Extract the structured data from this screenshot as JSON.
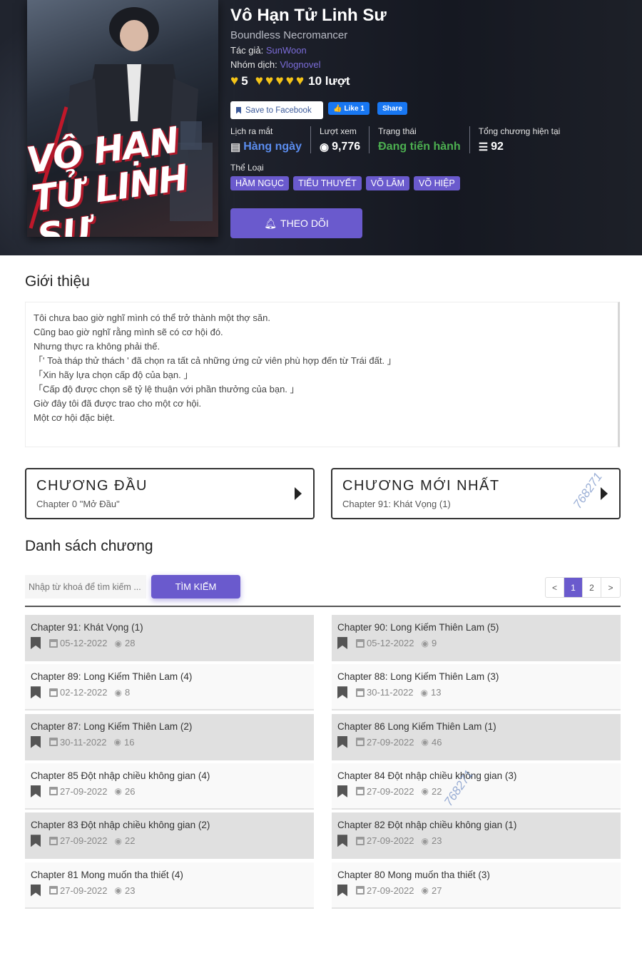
{
  "manga": {
    "title": "Vô Hạn Tử Linh Sư",
    "alt_title": "Boundless Necromancer",
    "author_label": "Tác giả:",
    "author": "SunWoon",
    "group_label": "Nhóm dịch:",
    "group": "Vlognovel",
    "rating_value": "5",
    "rating_count": "10 lượt",
    "cover_text": "VÔ HẠN TỬ LINH SƯ"
  },
  "social": {
    "save_fb": "Save to Facebook",
    "like": "Like 1",
    "share": "Share"
  },
  "stats": {
    "release_label": "Lịch ra mắt",
    "release_value": "Hàng ngày",
    "views_label": "Lượt xem",
    "views_value": "9,776",
    "status_label": "Trạng thái",
    "status_value": "Đang tiến hành",
    "chapters_label": "Tổng chương hiện tại",
    "chapters_value": "92"
  },
  "genres_label": "Thể Loại",
  "genres": [
    "HẦM NGỤC",
    "TIỂU THUYẾT",
    "VÕ LÂM",
    "VÕ HIỆP"
  ],
  "follow_label": "THEO DÕI",
  "intro": {
    "title": "Giới thiệu",
    "lines": [
      "Tôi chưa bao giờ nghĩ mình có thể trở thành một thợ săn.",
      "Cũng bao giờ nghĩ rằng mình sẽ có cơ hội đó.",
      "Nhưng thực ra không phải thế.",
      "「' Toà tháp thử thách ' đã chọn ra tất cả những ứng cử viên phù hợp đến từ Trái đất. 」",
      "「Xin hãy lựa chọn cấp độ của bạn. 」",
      "「Cấp độ được chọn sẽ tỷ lệ thuận với phần thưởng của bạn. 」",
      "Giờ đây tôi đã được trao cho một cơ hội.",
      "Một cơ hội đặc biệt."
    ]
  },
  "first_chapter": {
    "heading": "CHƯƠNG ĐẦU",
    "sub": "Chapter 0 \"Mở Đầu\""
  },
  "latest_chapter": {
    "heading": "CHƯƠNG MỚI NHẤT",
    "sub": "Chapter 91: Khát Vọng (1)"
  },
  "list": {
    "title": "Danh sách chương",
    "search_placeholder": "Nhập từ khoá để tìm kiếm ...",
    "search_button": "TÌM KIẾM",
    "pager": [
      "<",
      "1",
      "2",
      ">"
    ],
    "chapters": [
      {
        "name": "Chapter 91: Khát Vọng (1)",
        "date": "05-12-2022",
        "views": "28"
      },
      {
        "name": "Chapter 90: Long Kiếm Thiên Lam (5)",
        "date": "05-12-2022",
        "views": "9"
      },
      {
        "name": "Chapter 89: Long Kiếm Thiên Lam (4)",
        "date": "02-12-2022",
        "views": "8"
      },
      {
        "name": "Chapter 88: Long Kiếm Thiên Lam (3)",
        "date": "30-11-2022",
        "views": "13"
      },
      {
        "name": "Chapter 87: Long Kiếm Thiên Lam (2)",
        "date": "30-11-2022",
        "views": "16"
      },
      {
        "name": "Chapter 86 Long Kiếm Thiên Lam (1)",
        "date": "27-09-2022",
        "views": "46"
      },
      {
        "name": "Chapter 85 Đột nhập chiều không gian (4)",
        "date": "27-09-2022",
        "views": "26"
      },
      {
        "name": "Chapter 84 Đột nhập chiều không gian (3)",
        "date": "27-09-2022",
        "views": "22"
      },
      {
        "name": "Chapter 83 Đột nhập chiều không gian (2)",
        "date": "27-09-2022",
        "views": "22"
      },
      {
        "name": "Chapter 82 Đột nhập chiều không gian (1)",
        "date": "27-09-2022",
        "views": "23"
      },
      {
        "name": "Chapter 81 Mong muốn tha thiết (4)",
        "date": "27-09-2022",
        "views": "23"
      },
      {
        "name": "Chapter 80 Mong muốn tha thiết (3)",
        "date": "27-09-2022",
        "views": "27"
      }
    ]
  },
  "watermark": "768271",
  "colors": {
    "accent": "#6a5acd",
    "status_green": "#4caf50",
    "release_blue": "#5b8def",
    "heart": "#f5c518"
  }
}
